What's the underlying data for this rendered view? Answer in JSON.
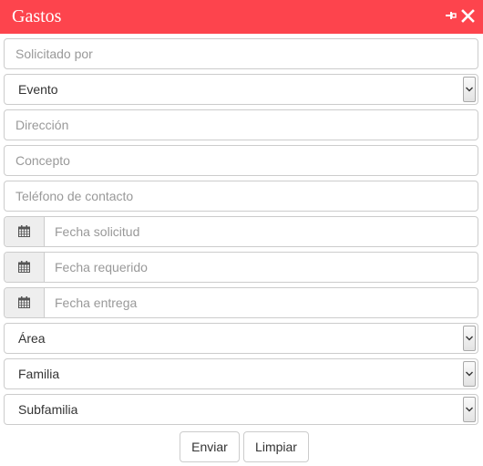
{
  "window": {
    "title": "Gastos"
  },
  "form": {
    "solicitado_por": {
      "placeholder": "Solicitado por"
    },
    "evento": {
      "value": "Evento"
    },
    "direccion": {
      "placeholder": "Dirección"
    },
    "concepto": {
      "placeholder": "Concepto"
    },
    "telefono": {
      "placeholder": "Teléfono de contacto"
    },
    "fecha_solicitud": {
      "placeholder": "Fecha solicitud"
    },
    "fecha_requerido": {
      "placeholder": "Fecha requerido"
    },
    "fecha_entrega": {
      "placeholder": "Fecha entrega"
    },
    "area": {
      "value": "Área"
    },
    "familia": {
      "value": "Familia"
    },
    "subfamilia": {
      "value": "Subfamilia"
    }
  },
  "buttons": {
    "submit": "Enviar",
    "clear": "Limpiar"
  },
  "icons": {
    "pin": "pin-icon",
    "close": "close-icon",
    "date": "calendar-icon",
    "dropdown": "chevron-down-icon"
  },
  "colors": {
    "header": "#fd444d",
    "header_text": "#ffffff"
  }
}
